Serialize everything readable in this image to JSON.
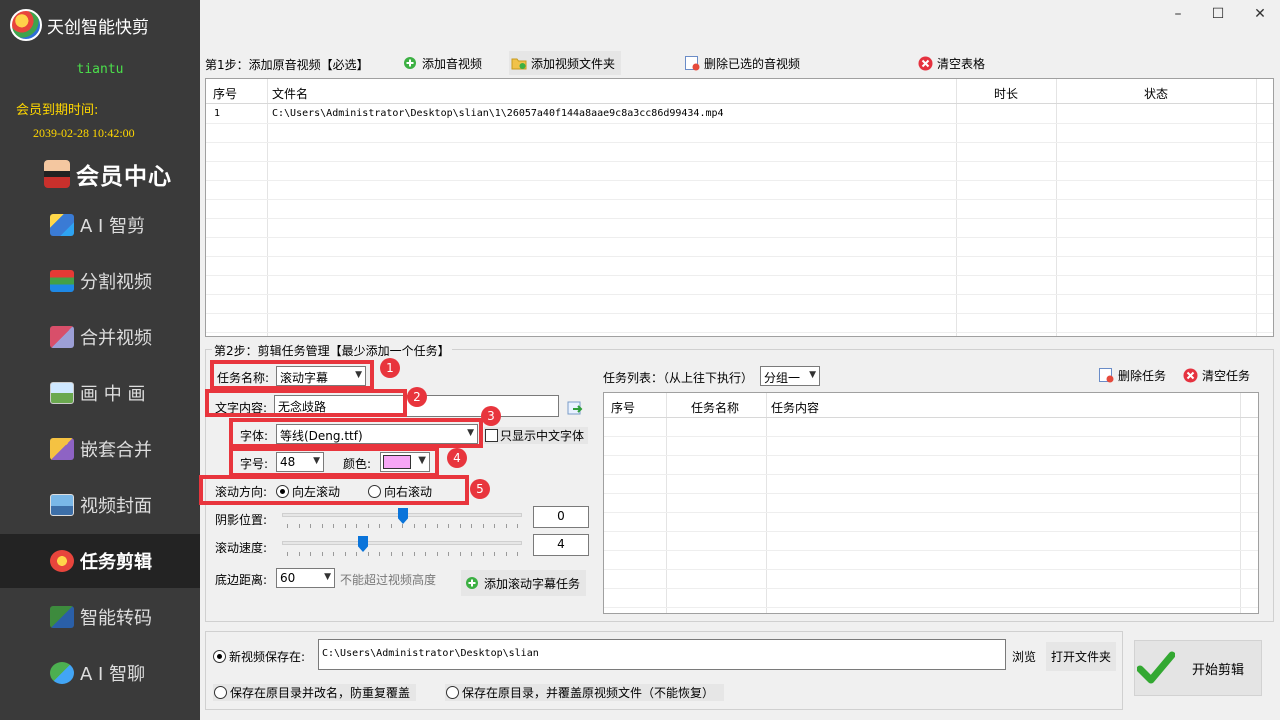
{
  "app": {
    "title": "天创智能快剪"
  },
  "sidebar": {
    "username": "tiantu",
    "expire_label": "会员到期时间:",
    "expire_date": "2039-02-28 10:42:00",
    "member_center": "会员中心",
    "items": [
      {
        "label": "A I 智剪",
        "icon": "ai-cut-icon",
        "active": false
      },
      {
        "label": "分割视频",
        "icon": "split-video-icon",
        "active": false
      },
      {
        "label": "合并视频",
        "icon": "merge-video-icon",
        "active": false
      },
      {
        "label": "画 中 画",
        "icon": "picture-in-picture-icon",
        "active": false
      },
      {
        "label": "嵌套合并",
        "icon": "nested-merge-icon",
        "active": false
      },
      {
        "label": "视频封面",
        "icon": "video-cover-icon",
        "active": false
      },
      {
        "label": "任务剪辑",
        "icon": "task-edit-icon",
        "active": true
      },
      {
        "label": "智能转码",
        "icon": "transcode-icon",
        "active": false
      },
      {
        "label": "A I 智聊",
        "icon": "ai-chat-icon",
        "active": false
      }
    ]
  },
  "window": {
    "minimize": "–",
    "maximize": "☐",
    "close": "✕"
  },
  "step1": {
    "label": "第1步：添加原音视频【必选】",
    "add_video": "添加音视频",
    "add_folder": "添加视频文件夹",
    "delete_selected": "删除已选的音视频",
    "clear_table": "清空表格",
    "columns": [
      "序号",
      "文件名",
      "时长",
      "状态"
    ],
    "rows": [
      {
        "index": "1",
        "filename": "C:\\Users\\Administrator\\Desktop\\slian\\1\\26057a40f144a8aae9c8a3cc86d99434.mp4",
        "duration": "",
        "status": ""
      }
    ]
  },
  "step2": {
    "label": "第2步：剪辑任务管理【最少添加一个任务】",
    "task_name_label": "任务名称:",
    "task_name_value": "滚动字幕",
    "text_label": "文字内容:",
    "text_value": "无念歧路",
    "font_label": "字体:",
    "font_value": "等线(Deng.ttf)",
    "chinese_only": "只显示中文字体",
    "size_label": "字号:",
    "size_value": "48",
    "color_label": "颜色:",
    "color_value": "#f7a6f5",
    "direction_label": "滚动方向:",
    "dir_left": "向左滚动",
    "dir_right": "向右滚动",
    "shadow_label": "阴影位置:",
    "shadow_value": "0",
    "speed_label": "滚动速度:",
    "speed_value": "4",
    "bottom_label": "底边距离:",
    "bottom_value": "60",
    "bottom_hint": "不能超过视频高度",
    "add_task": "添加滚动字幕任务",
    "badges": [
      "1",
      "2",
      "3",
      "4",
      "5"
    ]
  },
  "tasks": {
    "label": "任务列表：（从上往下执行）",
    "group_value": "分组一",
    "delete_task": "删除任务",
    "clear_task": "清空任务",
    "columns": [
      "序号",
      "任务名称",
      "任务内容"
    ]
  },
  "output": {
    "save_to_label": "新视频保存在:",
    "save_path": "C:\\Users\\Administrator\\Desktop\\slian",
    "browse": "浏览",
    "open_folder": "打开文件夹",
    "rename_option": "保存在原目录并改名，防重复覆盖",
    "overwrite_option": "保存在原目录，并覆盖原视频文件（不能恢复）",
    "start": "开始剪辑"
  }
}
